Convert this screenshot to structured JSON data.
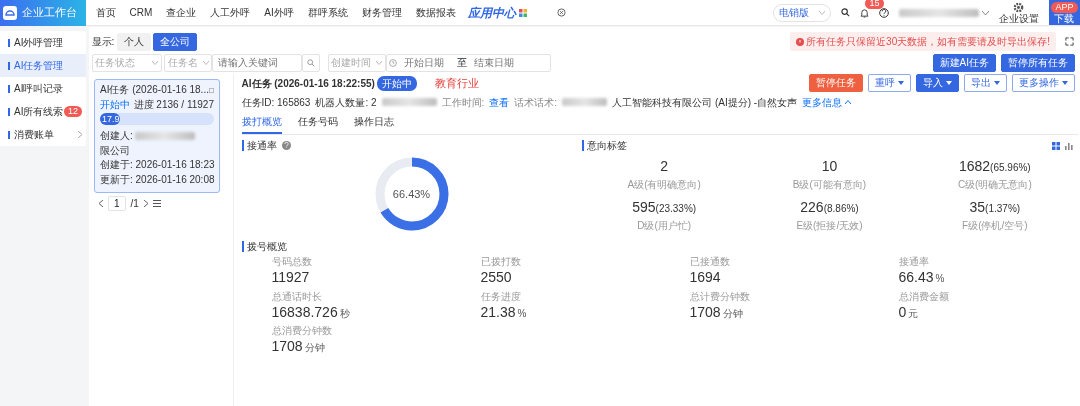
{
  "brand": {
    "title": "企业工作台"
  },
  "nav": [
    {
      "label": "首页",
      "selected": false
    },
    {
      "label": "CRM",
      "selected": false
    },
    {
      "label": "查企业",
      "selected": false
    },
    {
      "label": "人工外呼",
      "selected": false
    },
    {
      "label": "AI外呼",
      "selected": false
    },
    {
      "label": "群呼系统",
      "selected": false
    },
    {
      "label": "财务管理",
      "selected": false
    },
    {
      "label": "数据报表",
      "selected": false
    }
  ],
  "app_center": "应用中心",
  "version_select": "电销版",
  "notifications": "15",
  "settings": "企业设置",
  "app_download": {
    "badge": "APP",
    "label": "下载"
  },
  "sidebar": [
    {
      "label": "AI外呼管理",
      "selected": false,
      "kind": "link"
    },
    {
      "label": "AI任务管理",
      "selected": true,
      "kind": "link"
    },
    {
      "label": "AI呼叫记录",
      "selected": false,
      "kind": "link"
    },
    {
      "label": "AI所有线索",
      "selected": false,
      "kind": "link",
      "badge": "12"
    },
    {
      "label": "消费账单",
      "selected": false,
      "kind": "submenu"
    }
  ],
  "scope": {
    "label": "显示:",
    "options": [
      {
        "label": "个人",
        "selected": false
      },
      {
        "label": "全公司",
        "selected": true
      }
    ]
  },
  "filters": {
    "status": "任务状态",
    "name_type": "任务名",
    "keyword_placeholder": "请输入关键词",
    "time_type": "创建时间",
    "start_placeholder": "开始日期",
    "separator": "至",
    "end_placeholder": "结束日期"
  },
  "alert": "所有任务只保留近30天数据，如有需要请及时导出保存!",
  "actions": [
    "新建AI任务",
    "暂停所有任务"
  ],
  "industry_tag": "教育行业",
  "task_cards": [
    {
      "title": "AI任务 (2026-01-16 18...",
      "status": "开始中",
      "progress_text": "进度 2136 / 11927",
      "level": 0.179,
      "level_label": "17.9",
      "creator_label": "创建人:",
      "creator_tail": "限公司",
      "created": "创建于: 2026-01-16 18:23",
      "updated": "更新于: 2026-01-16 20:08",
      "selected": true
    }
  ],
  "pager": {
    "page": "1",
    "total": "/1"
  },
  "detail": {
    "title": "AI任务 (2026-01-16 18:22:55)",
    "status": "开始中",
    "task_id": "任务ID: 165863",
    "robots": "机器人数量: 2",
    "work_time_label": "工作时间:",
    "work_time_link": "查看",
    "script_label": "话术话术:",
    "script_value": "人工智能科技有限公司 (AI提分) -自然女声",
    "more_info": "更多信息",
    "buttons": [
      {
        "label": "暂停任务",
        "kind": "danger",
        "caret": false
      },
      {
        "label": "重呼",
        "kind": "outline",
        "caret": true
      },
      {
        "label": "导入",
        "kind": "primary",
        "caret": true
      },
      {
        "label": "导出",
        "kind": "outline",
        "caret": true
      },
      {
        "label": "更多操作",
        "kind": "outline",
        "caret": true
      }
    ],
    "tabs": [
      {
        "label": "拨打概览",
        "selected": true
      },
      {
        "label": "任务号码",
        "selected": false
      },
      {
        "label": "操作日志",
        "selected": false
      }
    ]
  },
  "connect_rate": {
    "title": "接通率",
    "level": 0.6643,
    "reading": "66.43%"
  },
  "intent": {
    "title": "意向标签",
    "items": [
      {
        "value": "2",
        "label": "A级(有明确意向)"
      },
      {
        "value": "10",
        "label": "B级(可能有意向)"
      },
      {
        "value": "1682",
        "percent": "(65.96%)",
        "label": "C级(明确无意向)"
      },
      {
        "value": "595",
        "percent": "(23.33%)",
        "label": "D级(用户忙)"
      },
      {
        "value": "226",
        "percent": "(8.86%)",
        "label": "E级(拒接/无效)"
      },
      {
        "value": "35",
        "percent": "(1.37%)",
        "label": "F级(停机/空号)"
      }
    ]
  },
  "dial": {
    "title": "拨号概览",
    "items": [
      {
        "label": "号码总数",
        "value": "11927"
      },
      {
        "label": "已拨打数",
        "value": "2550"
      },
      {
        "label": "已接通数",
        "value": "1694"
      },
      {
        "label": "接通率",
        "value": "66.43",
        "unit": "%"
      },
      {
        "label": "总通话时长",
        "value": "16838.726",
        "unit": "秒"
      },
      {
        "label": "任务进度",
        "value": "21.38",
        "unit": "%"
      },
      {
        "label": "总计费分钟数",
        "value": "1708",
        "unit": "分钟"
      },
      {
        "label": "总消费金额",
        "value": "0",
        "unit": "元"
      },
      {
        "label": "总消费分钟数",
        "value": "1708",
        "unit": "分钟"
      }
    ]
  }
}
